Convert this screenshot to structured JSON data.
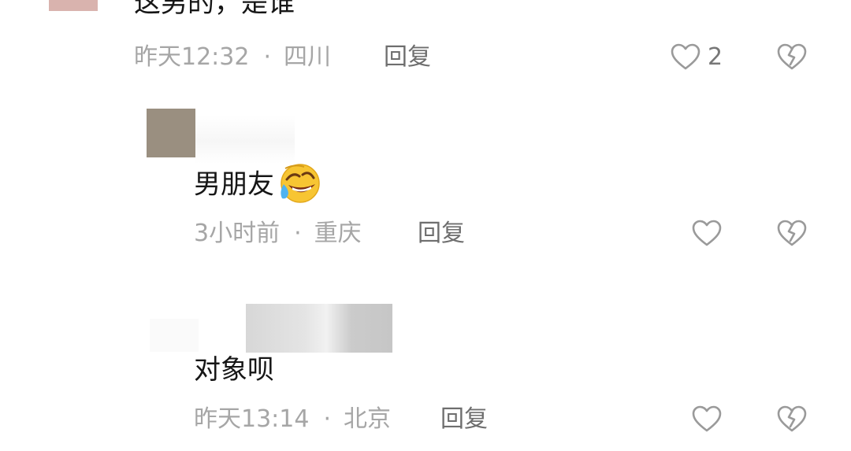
{
  "comments": [
    {
      "text": "这男的，是谁",
      "time": "昨天12:32",
      "separator": "·",
      "location": "四川",
      "reply_label": "回复",
      "like_count": "2"
    },
    {
      "text": "男朋友",
      "emoji": "face-with-tears-of-joy-icon",
      "time": "3小时前",
      "separator": "·",
      "location": "重庆",
      "reply_label": "回复"
    },
    {
      "text": "对象呗",
      "time": "昨天13:14",
      "separator": "·",
      "location": "北京",
      "reply_label": "回复"
    }
  ],
  "colors": {
    "text": "#161616",
    "meta": "#a6a6a6",
    "reply": "#6e6e6e",
    "icon": "#9a9a9a"
  }
}
